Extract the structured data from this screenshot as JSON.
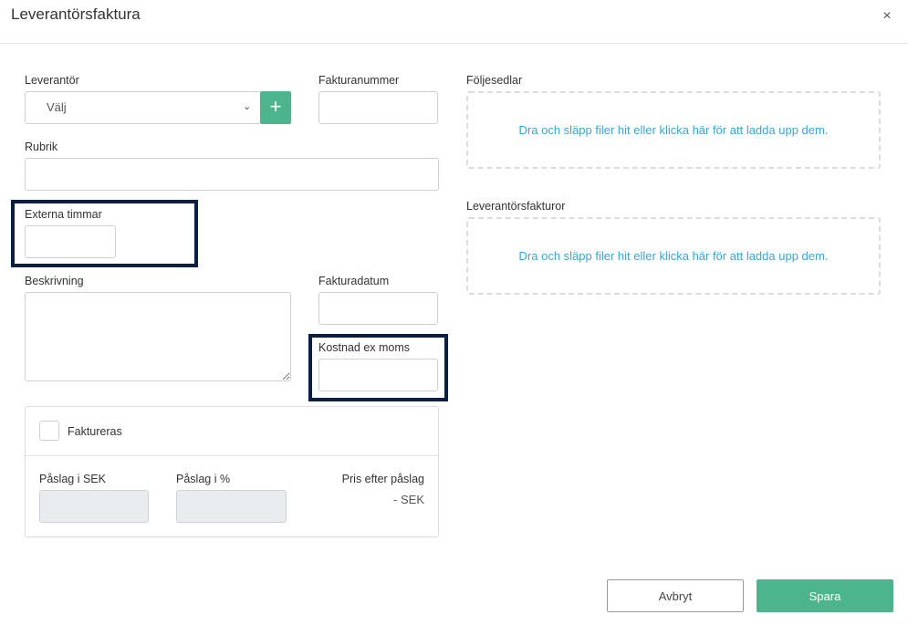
{
  "dialog": {
    "title": "Leverantörsfaktura",
    "close_glyph": "×"
  },
  "form": {
    "supplier": {
      "label": "Leverantör",
      "value": "Välj",
      "chevron": "⌄",
      "add_glyph": "+"
    },
    "invoice_number": {
      "label": "Fakturanummer",
      "value": ""
    },
    "subject": {
      "label": "Rubrik",
      "value": ""
    },
    "external_hours": {
      "label": "Externa timmar",
      "value": ""
    },
    "description": {
      "label": "Beskrivning",
      "value": ""
    },
    "invoice_date": {
      "label": "Fakturadatum",
      "value": ""
    },
    "cost_ex_vat": {
      "label": "Kostnad ex moms",
      "value": ""
    }
  },
  "billing": {
    "checkbox_label": "Faktureras",
    "markup_sek_label": "Påslag i SEK",
    "markup_pct_label": "Påslag i %",
    "price_after_label": "Pris efter påslag",
    "price_after_value": "- SEK"
  },
  "uploads": {
    "delivery_notes": {
      "label": "Följesedlar",
      "dropzone_text": "Dra och släpp filer hit eller klicka här för att ladda upp dem."
    },
    "supplier_invoices": {
      "label": "Leverantörsfakturor",
      "dropzone_text": "Dra och släpp filer hit eller klicka här för att ladda upp dem."
    }
  },
  "footer": {
    "cancel_label": "Avbryt",
    "save_label": "Spara"
  },
  "colors": {
    "accent": "#4cb58e",
    "highlight_border": "#0b1f45",
    "link": "#3aa4d6"
  }
}
